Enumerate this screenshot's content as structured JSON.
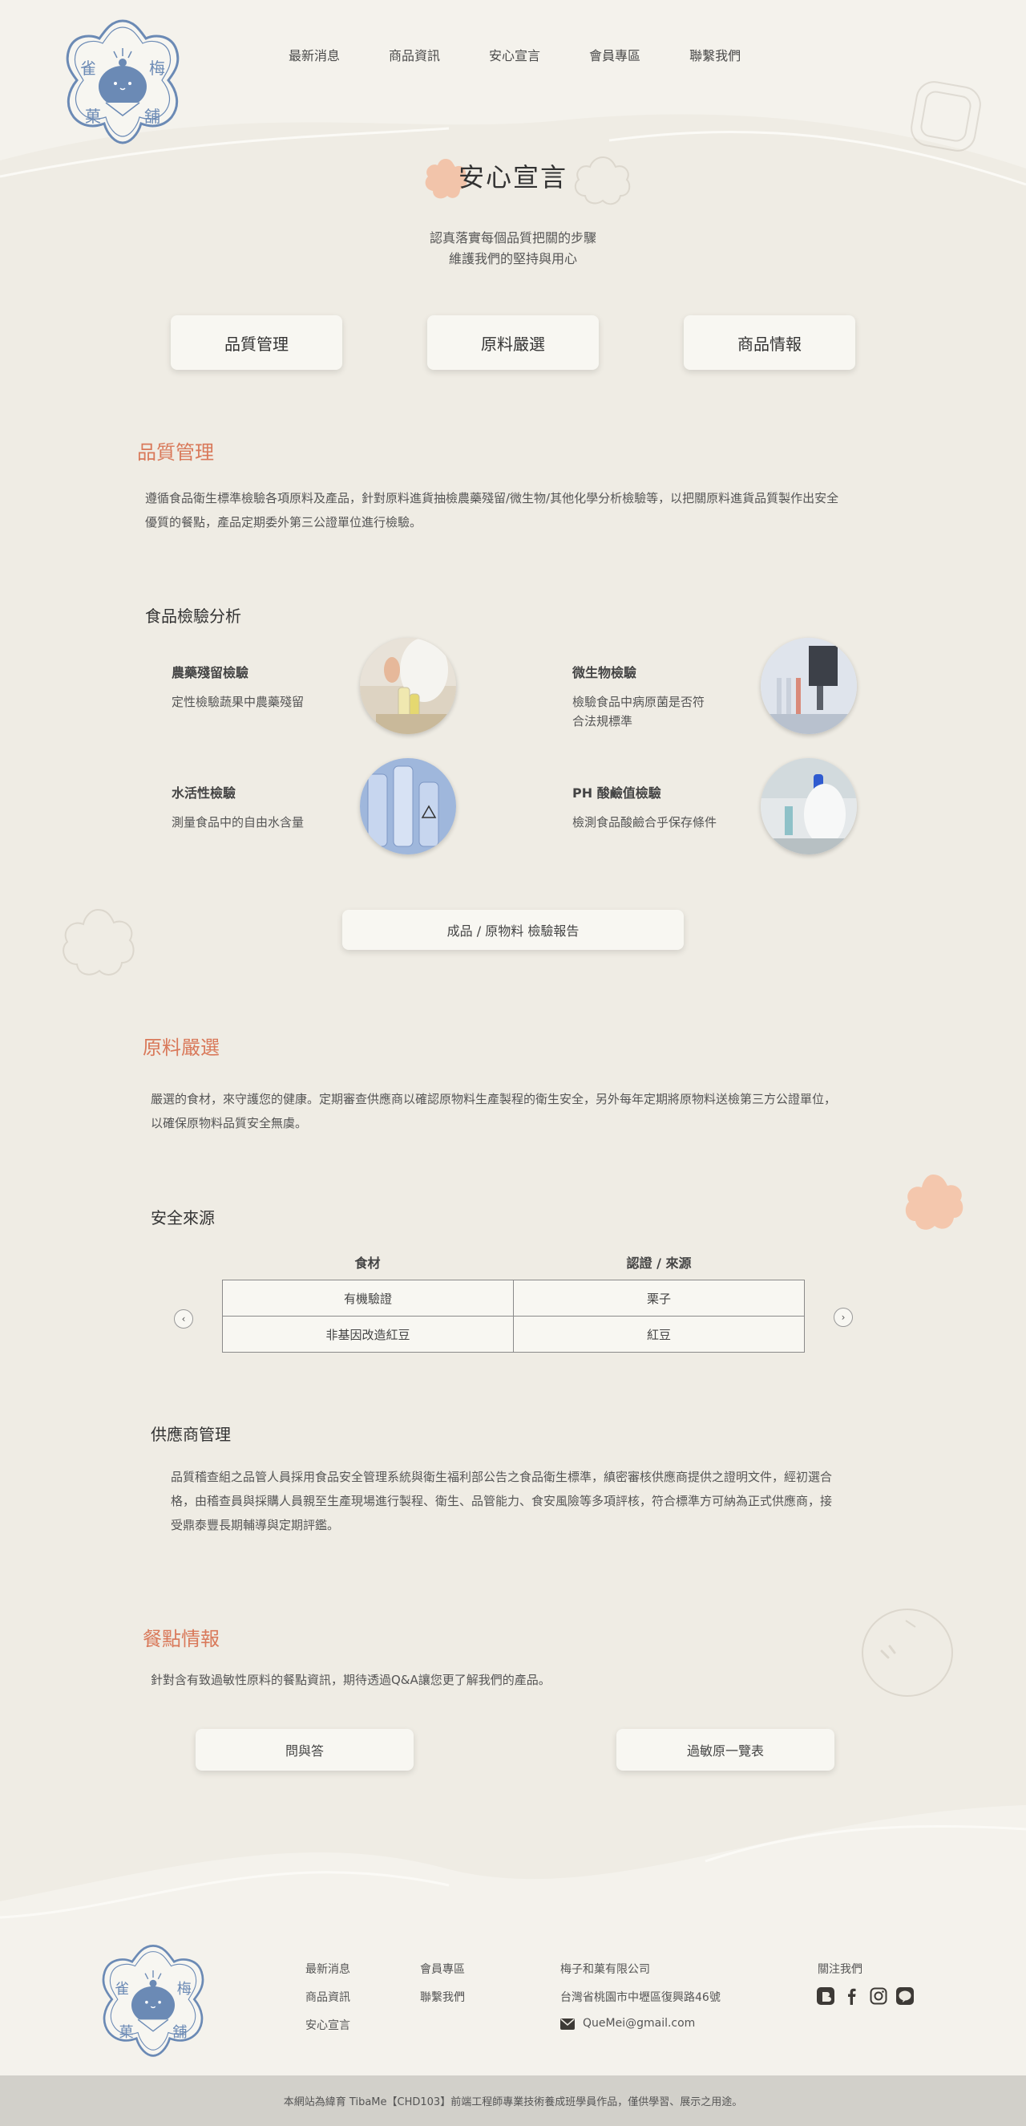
{
  "brand": {
    "logo_text": [
      "雀",
      "梅",
      "菓",
      "舖"
    ]
  },
  "nav": {
    "items": [
      "最新消息",
      "商品資訊",
      "安心宣言",
      "會員專區",
      "聯繫我們"
    ]
  },
  "hero": {
    "title": "安心宣言",
    "subtitle_line1": "認真落實每個品質把關的步驟",
    "subtitle_line2": "維護我們的堅持與用心"
  },
  "tabs": [
    "品質管理",
    "原料嚴選",
    "商品情報"
  ],
  "quality": {
    "title": "品質管理",
    "text_line1": "遵循食品衛生標準檢驗各項原料及產品，針對原料進貨抽檢農藥殘留/微生物/其他化學分析檢驗等，以把關原料進貨品質製作出安全",
    "text_line2": "優質的餐點，產品定期委外第三公證單位進行檢驗。",
    "analysis_title": "食品檢驗分析",
    "tests": [
      {
        "name": "農藥殘留檢驗",
        "desc": "定性檢驗蔬果中農藥殘留"
      },
      {
        "name": "微生物檢驗",
        "desc_line1": "檢驗食品中病原菌是否符",
        "desc_line2": "合法規標準"
      },
      {
        "name": "水活性檢驗",
        "desc": "測量食品中的自由水含量"
      },
      {
        "name": "PH 酸鹼值檢驗",
        "desc": "檢測食品酸鹼合乎保存條件"
      }
    ],
    "report_button": "成品 / 原物料 檢驗報告"
  },
  "ingredients": {
    "title": "原料嚴選",
    "text_line1": "嚴選的食材，來守護您的健康。定期審查供應商以確認原物料生產製程的衛生安全，另外每年定期將原物料送檢第三方公證單位，",
    "text_line2": "以確保原物料品質安全無虞。",
    "source_title": "安全來源",
    "table_headers": [
      "食材",
      "認證 / 來源"
    ],
    "table_rows": [
      [
        "有機驗證",
        "栗子"
      ],
      [
        "非基因改造紅豆",
        "紅豆"
      ]
    ],
    "supplier_title": "供應商管理",
    "supplier_line1": "品質稽查組之品管人員採用食品安全管理系統與衛生福利部公告之食品衛生標準，縝密審核供應商提供之證明文件，經初選合",
    "supplier_line2": "格，由稽查員與採購人員親至生產現場進行製程、衛生、品管能力、食安風險等多項評核，符合標準方可納為正式供應商，接",
    "supplier_line3": "受鼎泰豐長期輔導與定期評鑑。"
  },
  "product_info": {
    "title": "餐點情報",
    "text": "針對含有致過敏性原料的餐點資訊，期待透過Q&A讓您更了解我們的產品。",
    "buttons": [
      "問與答",
      "過敏原一覽表"
    ]
  },
  "footer": {
    "links_col1": [
      "最新消息",
      "商品資訊",
      "安心宣言"
    ],
    "links_col2": [
      "會員專區",
      "聯繫我們"
    ],
    "company": "梅子和菓有限公司",
    "address": "台灣省桃園市中壢區復興路46號",
    "email": "QueMei@gmail.com",
    "follow": "關注我們",
    "social_icons": [
      "blogger-icon",
      "facebook-icon",
      "instagram-icon",
      "line-icon"
    ],
    "copyright": "本網站為緯育 TibaMe【CHD103】前端工程師專業技術養成班學員作品，僅供學習、展示之用途。"
  },
  "colors": {
    "background": "#efece4",
    "accent": "#d9795a",
    "logo_blue": "#6b8ab5",
    "footer_bar": "#d2d0ca"
  }
}
